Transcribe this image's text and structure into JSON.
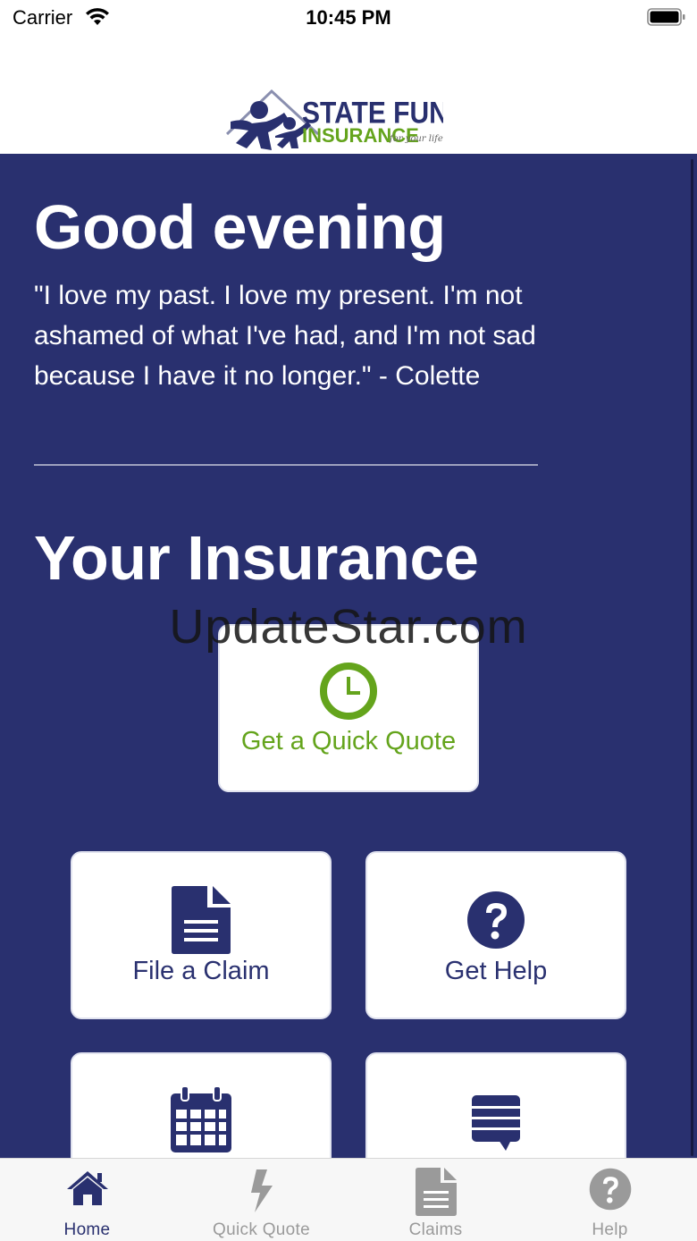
{
  "status_bar": {
    "carrier": "Carrier",
    "time": "10:45 PM"
  },
  "header": {
    "logo": {
      "line1": "STATE FUND",
      "line2": "INSURANCE",
      "tagline": "for your life"
    }
  },
  "main": {
    "greeting": "Good evening",
    "quote": "\"I love my past. I love my present. I'm not ashamed of what I've had, and I'm not sad because I have it no longer.\" - Colette",
    "section_title": "Your Insurance",
    "watermark": "UpdateStar.com",
    "cards": {
      "quick_quote": {
        "label": "Get a Quick Quote",
        "icon": "clock-icon"
      },
      "file_claim": {
        "label": "File a Claim",
        "icon": "document-icon"
      },
      "get_help": {
        "label": "Get Help",
        "icon": "question-circle-icon"
      },
      "calendar": {
        "icon": "calendar-icon"
      },
      "messages": {
        "icon": "message-icon"
      }
    }
  },
  "tabs": [
    {
      "label": "Home",
      "icon": "home-icon",
      "active": true
    },
    {
      "label": "Quick Quote",
      "icon": "lightning-icon",
      "active": false
    },
    {
      "label": "Claims",
      "icon": "document-icon",
      "active": false
    },
    {
      "label": "Help",
      "icon": "question-circle-icon",
      "active": false
    }
  ],
  "colors": {
    "brand_navy": "#29306f",
    "brand_green": "#64a41c",
    "inactive_tab": "#9a9a9a"
  }
}
